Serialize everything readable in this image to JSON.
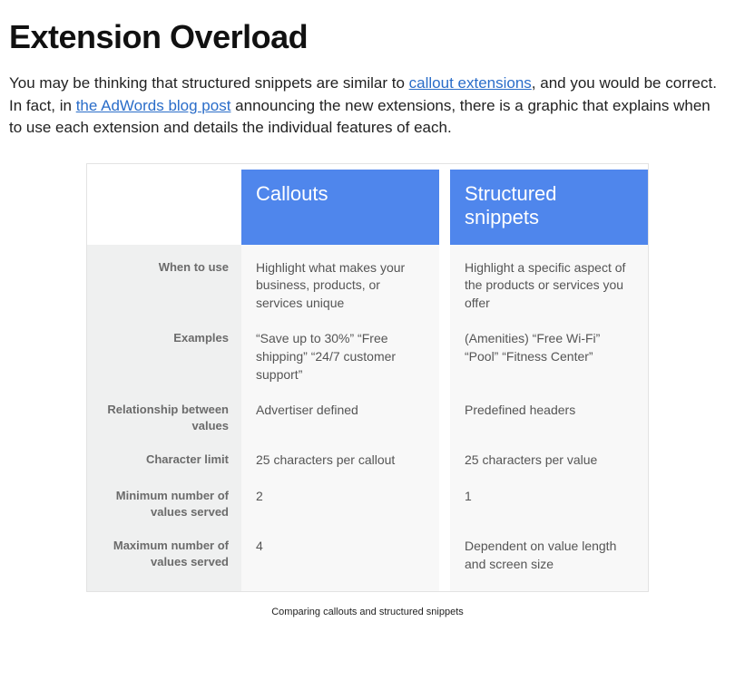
{
  "heading": "Extension Overload",
  "intro": {
    "pre1": "You may be thinking that structured snippets are similar to ",
    "link1": "callout extensions",
    "mid1": ", and you would be correct. In fact, in ",
    "link2": "the AdWords blog post",
    "post1": " announcing the new extensions, there is a graphic that explains when to use each extension and details the individual features of each."
  },
  "table": {
    "header_col1": "Callouts",
    "header_col2": "Structured snippets",
    "rows": [
      {
        "label": "When to use",
        "col1": "Highlight what makes your business, products, or services unique",
        "col2": "Highlight a specific aspect of the products or services you offer"
      },
      {
        "label": "Examples",
        "col1": "“Save up to 30%” “Free shipping” “24/7 customer support”",
        "col2": "(Amenities) “Free Wi-Fi” “Pool” “Fitness Center”"
      },
      {
        "label": "Relationship between values",
        "col1": "Advertiser defined",
        "col2": "Predefined headers"
      },
      {
        "label": "Character limit",
        "col1": "25 characters per callout",
        "col2": "25 characters per value"
      },
      {
        "label": "Minimum number of values served",
        "col1": "2",
        "col2": "1"
      },
      {
        "label": "Maximum number of values served",
        "col1": "4",
        "col2": "Dependent on value length and screen size"
      }
    ]
  },
  "caption": "Comparing callouts and structured snippets"
}
